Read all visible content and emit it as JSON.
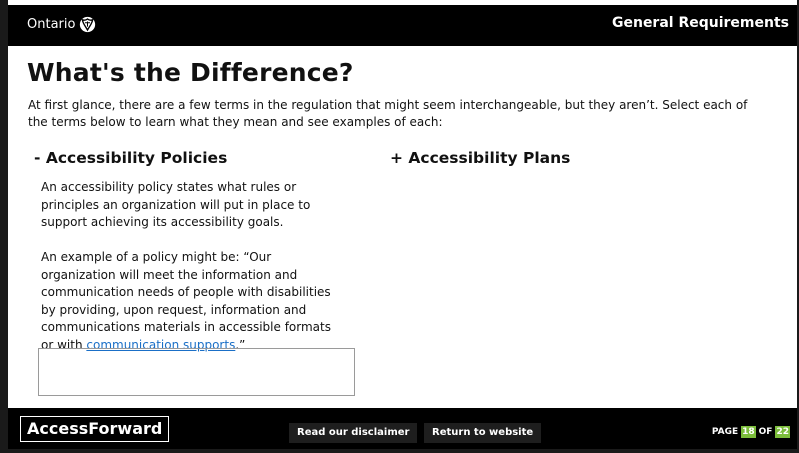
{
  "header": {
    "logo_text": "Ontario",
    "logo_icon": "ontario-trillium-icon",
    "section_title": "General Requirements"
  },
  "main": {
    "title": "What's the Difference?",
    "intro": "At first glance, there are a few terms in the regulation that might seem interchangeable, but they aren’t. Select each of the terms below to learn what they mean and see examples of each:",
    "terms": [
      {
        "label": "- Accessibility Policies",
        "expanded": true,
        "paragraph_1": "An accessibility policy states what rules or principles an organization will put in place to support achieving its accessibility goals.",
        "paragraph_2_before_link": "An example of a policy might be: “Our organization will meet the information and communication needs of people with disabilities by providing, upon request, information and communications materials in accessible formats or with ",
        "paragraph_2_link": "communication supports",
        "paragraph_2_after_link": ".”"
      },
      {
        "label": "+ Accessibility Plans",
        "expanded": false
      }
    ]
  },
  "footer": {
    "brand": "AccessForward",
    "disclaimer_label": "Read our disclaimer",
    "return_label": "Return to website",
    "page_label": "PAGE",
    "current_page": "18",
    "of_label": "OF",
    "total_pages": "22"
  },
  "colors": {
    "bar_background": "#000000",
    "link": "#1a6fc7",
    "page_badge": "#7cbd3b"
  }
}
